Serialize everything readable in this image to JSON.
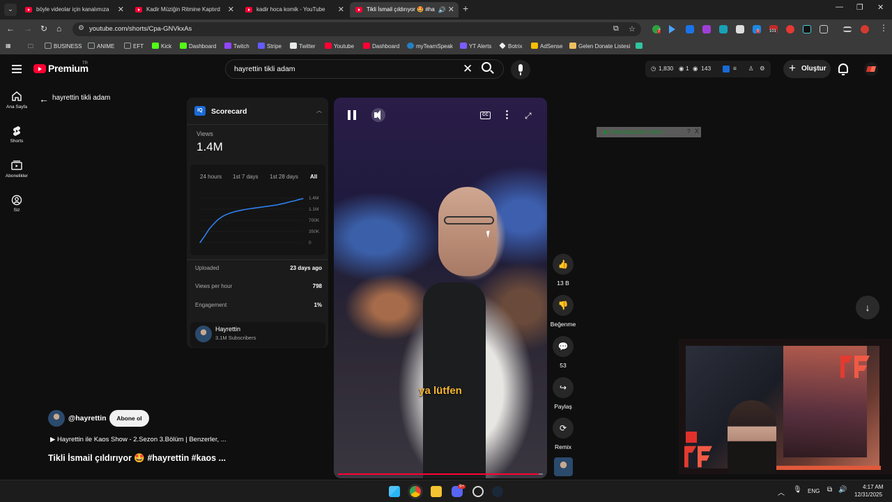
{
  "browser": {
    "tabs": [
      {
        "title": "böyle videolar için kanalımıza üye ol",
        "active": false
      },
      {
        "title": "Kadir Müziğin Ritmine Kaptırdı",
        "active": false
      },
      {
        "title": "kadir hoca komik - YouTube",
        "active": false
      },
      {
        "title": "Tikli İsmail çıldırıyor 🤩 #hayrettin",
        "active": true
      }
    ],
    "url": "youtube.com/shorts/Cpa-GNVkxAs",
    "ext_badges": {
      "first": "7",
      "second": "0",
      "third": "101"
    },
    "bookmarks": [
      {
        "label": "BUSINESS",
        "color": "#9aa0a6"
      },
      {
        "label": "ANIME",
        "color": "#9aa0a6"
      },
      {
        "label": "EFT",
        "color": "#9aa0a6"
      },
      {
        "label": "Kick",
        "color": "#53fc18"
      },
      {
        "label": "Dashboard",
        "color": "#53fc18"
      },
      {
        "label": "Twitch",
        "color": "#9146ff"
      },
      {
        "label": "Stripe",
        "color": "#635bff"
      },
      {
        "label": "Twitter",
        "color": "#e7e9ea"
      },
      {
        "label": "Youtube",
        "color": "#ff0033"
      },
      {
        "label": "Dashboard",
        "color": "#ff0033"
      },
      {
        "label": "myTeamSpeak",
        "color": "#2580c3"
      },
      {
        "label": "YT Alerts",
        "color": "#7c5cff"
      },
      {
        "label": "Botrix",
        "color": "#eee"
      },
      {
        "label": "AdSense",
        "color": "#fbbc04"
      },
      {
        "label": "Gelen Donate Listesi",
        "color": "#f0c060"
      }
    ]
  },
  "youtube": {
    "brand": "Premium",
    "country": "TR",
    "search_query": "hayrettin tikli adam",
    "stats": {
      "a": "1,830",
      "b": "1",
      "c": "143"
    },
    "create_label": "Oluştur",
    "rail": [
      {
        "label": "Ana Sayfa",
        "icon": "home-icon"
      },
      {
        "label": "Shorts",
        "icon": "shorts-icon"
      },
      {
        "label": "Abonelikler",
        "icon": "subscriptions-icon"
      },
      {
        "label": "Siz",
        "icon": "you-icon"
      }
    ],
    "back_title": "hayrettin tikli adam"
  },
  "scorecard": {
    "title": "Scorecard",
    "views_label": "Views",
    "views_value": "1.4M",
    "tabs": [
      "24 hours",
      "1st 7 days",
      "1st 28 days",
      "All"
    ],
    "active_tab": "All",
    "y_ticks": [
      "1.4M",
      "1.1M",
      "700K",
      "350K",
      "0"
    ],
    "rows": [
      {
        "key": "Uploaded",
        "value": "23 days ago"
      },
      {
        "key": "Views per hour",
        "value": "798"
      },
      {
        "key": "Engagement",
        "value": "1%"
      }
    ],
    "channel": {
      "name": "Hayrettin",
      "subs": "3.1M Subscribers"
    }
  },
  "chart_data": {
    "type": "line",
    "title": "",
    "xlabel": "",
    "ylabel": "",
    "ylim": [
      0,
      1400000
    ],
    "x": [
      0,
      1,
      2,
      3,
      4,
      5,
      6,
      7,
      8,
      9,
      10,
      11,
      12,
      13,
      14,
      15,
      16,
      17,
      18,
      19,
      20,
      21,
      22,
      23
    ],
    "series": [
      {
        "values": [
          0,
          200000,
          420000,
          580000,
          720000,
          820000,
          890000,
          940000,
          980000,
          1010000,
          1040000,
          1060000,
          1080000,
          1100000,
          1120000,
          1140000,
          1160000,
          1180000,
          1210000,
          1240000,
          1280000,
          1310000,
          1350000,
          1380000
        ],
        "color": "#2f80ed"
      }
    ]
  },
  "video": {
    "subtitle": "ya lütfen",
    "progress": 0.98
  },
  "actions": [
    {
      "icon": "like-icon",
      "glyph": "👍",
      "label": "13 B"
    },
    {
      "icon": "dislike-icon",
      "glyph": "👎",
      "label": "Beğenme"
    },
    {
      "icon": "comment-icon",
      "glyph": "💬",
      "label": "53"
    },
    {
      "icon": "share-icon",
      "glyph": "↪",
      "label": "Paylaş"
    },
    {
      "icon": "remix-icon",
      "glyph": "⟳",
      "label": "Remix"
    }
  ],
  "meta": {
    "channel_handle": "@hayrettin",
    "subscribe_label": "Abone ol",
    "playlist": "▶ Hayrettin ile Kaos Show - 2.Sezon 3.Bölüm | Benzerler, ...",
    "title": "Tikli İsmail çıldırıyor 🤩 #hayrettin #kaos ..."
  },
  "download_bar": {
    "label": "▶ Download this video",
    "help": "?",
    "close": "X"
  },
  "taskbar": {
    "lang": "ENG",
    "time": "4:17 AM",
    "date": "12/31/2025",
    "discord_badge": "9+"
  }
}
